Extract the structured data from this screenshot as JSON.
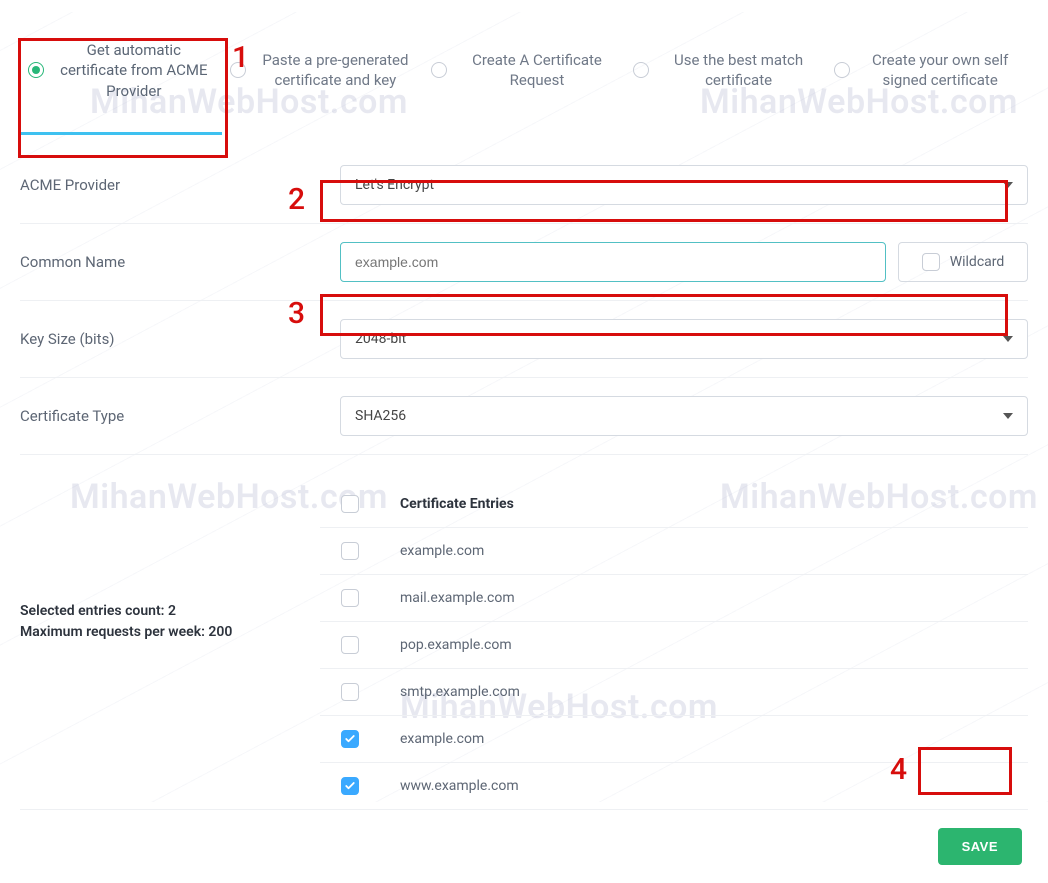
{
  "watermark_text": "MihanWebHost.com",
  "annotations": [
    "1",
    "2",
    "3",
    "4"
  ],
  "tabs": [
    {
      "label": "Get automatic certificate from ACME Provider",
      "selected": true
    },
    {
      "label": "Paste a pre-generated certificate and key",
      "selected": false
    },
    {
      "label": "Create A Certificate Request",
      "selected": false
    },
    {
      "label": "Use the best match certificate",
      "selected": false
    },
    {
      "label": "Create your own self signed certificate",
      "selected": false
    }
  ],
  "form": {
    "acme_provider": {
      "label": "ACME Provider",
      "value": "Let's Encrypt"
    },
    "common_name": {
      "label": "Common Name",
      "placeholder": "example.com",
      "wildcard_label": "Wildcard"
    },
    "key_size": {
      "label": "Key Size (bits)",
      "value": "2048-bit"
    },
    "cert_type": {
      "label": "Certificate Type",
      "value": "SHA256"
    }
  },
  "entries": {
    "header": "Certificate Entries",
    "summary": {
      "selected_count_label": "Selected entries count: 2",
      "max_label": "Maximum requests per week: 200"
    },
    "rows": [
      {
        "name": "example.com",
        "checked": false
      },
      {
        "name": "mail.example.com",
        "checked": false
      },
      {
        "name": "pop.example.com",
        "checked": false
      },
      {
        "name": "smtp.example.com",
        "checked": false
      },
      {
        "name": "example.com",
        "checked": true
      },
      {
        "name": "www.example.com",
        "checked": true
      }
    ]
  },
  "footer": {
    "save_label": "SAVE"
  }
}
